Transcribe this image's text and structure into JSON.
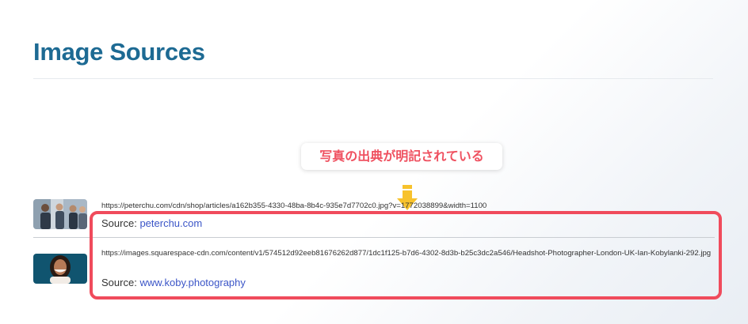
{
  "page": {
    "title": "Image Sources"
  },
  "callout": {
    "text": "写真の出典が明記されている"
  },
  "sources": [
    {
      "url": "https://peterchu.com/cdn/shop/articles/a162b355-4330-48ba-8b4c-935e7d7702c0.jpg?v=1772038899&width=1100",
      "source_label": "Source:",
      "link_text": "peterchu.com"
    },
    {
      "url": "https://images.squarespace-cdn.com/content/v1/574512d92eeb81676262d877/1dc1f125-b7d6-4302-8d3b-b25c3dc2a546/Headshot-Photographer-London-UK-Ian-Kobylanki-292.jpg",
      "source_label": "Source:",
      "link_text": "www.koby.photography"
    }
  ],
  "colors": {
    "title": "#1d6a93",
    "link": "#3b55c7",
    "highlight": "#f04b5c",
    "callout_text": "#ef5160",
    "arrow": "#f7c22c"
  }
}
